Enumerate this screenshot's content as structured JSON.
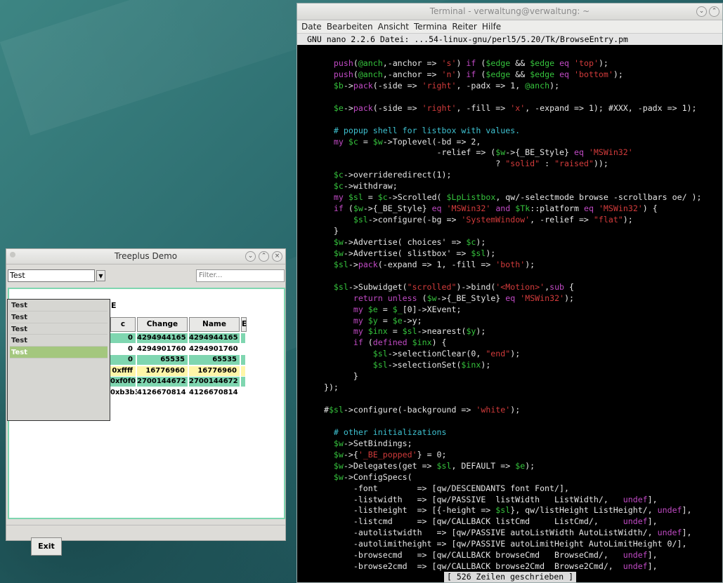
{
  "terminal": {
    "title": "Terminal - verwaltung@verwaltung: ~",
    "menu": [
      "Date",
      "Bearbeiten",
      "Ansicht",
      "Termina",
      "Reiter",
      "Hilfe"
    ],
    "nano_header": "GNU nano 2.2.6 Datei: ...54-linux-gnu/perl5/5.20/Tk/BrowseEntry.pm",
    "status": "[ 526 Zeilen geschrieben ]",
    "lines": [
      "",
      "    push(@anch,-anchor => 's') if ($edge && $edge eq 'top');",
      "    push(@anch,-anchor => 'n') if ($edge && $edge eq 'bottom');",
      "    $b->pack(-side => 'right', -padx => 1, @anch);",
      "",
      "    $e->pack(-side => 'right', -fill => 'x', -expand => 1); #XXX, -padx => 1);",
      "",
      "    # popup shell for listbox with values.",
      "    my $c = $w->Toplevel(-bd => 2,",
      "                         -relief => ($w->{_BE_Style} eq 'MSWin32'",
      "                                     ? \"solid\" : \"raised\"));",
      "    $c->overrideredirect(1);",
      "    $c->withdraw;",
      "    my $sl = $c->Scrolled( $LpListbox, qw/-selectmode browse -scrollbars oe/ );",
      "    if ($w->{_BE_Style} eq 'MSWin32' and $Tk::platform eq 'MSWin32') {",
      "        $sl->configure(-bg => 'SystemWindow', -relief => \"flat\");",
      "    }",
      "    $w->Advertise( choices' => $c);",
      "    $w->Advertise( slistbox' => $sl);",
      "    $sl->pack(-expand => 1, -fill => 'both');",
      "",
      "    $sl->Subwidget(\"scrolled\")->bind('<Motion>',sub {",
      "        return unless ($w->{_BE_Style} eq 'MSWin32');",
      "        my $e = $_[0]->XEvent;",
      "        my $y = $e->y;",
      "        my $inx = $sl->nearest($y);",
      "        if (defined $inx) {",
      "            $sl->selectionClear(0, \"end\");",
      "            $sl->selectionSet($inx);",
      "        }",
      "  });",
      "",
      "  #$sl->configure(-background => 'white');",
      "",
      "    # other initializations",
      "    $w->SetBindings;",
      "    $w->{'_BE_popped'} = 0;",
      "    $w->Delegates(get => $sl, DEFAULT => $e);",
      "    $w->ConfigSpecs(",
      "        -font        => [qw/DESCENDANTS font Font/],",
      "        -listwidth   => [qw/PASSIVE  listWidth   ListWidth/,   undef],",
      "        -listheight  => [{-height => $sl}, qw/listHeight ListHeight/, undef],",
      "        -listcmd     => [qw/CALLBACK listCmd     ListCmd/,     undef],",
      "        -autolistwidth   => [qw/PASSIVE autoListWidth AutoListWidth/, undef],",
      "        -autolimitheight => [qw/PASSIVE autoLimitHeight AutoLimitHeight 0/],",
      "        -browsecmd   => [qw/CALLBACK browseCmd   BrowseCmd/,   undef],",
      "        -browse2cmd  => [qw/CALLBACK browse2Cmd  Browse2Cmd/,  undef],"
    ],
    "colors": {
      "green": "#35c23c",
      "cyan": "#3ec1d0",
      "magenta": "#c04ac4",
      "red": "#d23b3b",
      "default": "#e6e6e6"
    }
  },
  "treeplus": {
    "title": "Treeplus Demo",
    "combo_value": "Test",
    "filter_placeholder": "Filter...",
    "tab_label": "E",
    "columns": [
      "Change",
      "Name"
    ],
    "dropdown_items": [
      "Test",
      "Test",
      "Test",
      "Test",
      "Test"
    ],
    "rows": [
      {
        "c0": "0",
        "c1": "4294944165",
        "c2": "4294944165",
        "bg": "#7fd6b0"
      },
      {
        "c0": "0",
        "c1": "4294901760",
        "c2": "4294901760",
        "bg": "#ffffff"
      },
      {
        "c0": "0",
        "c1": "65535",
        "c2": "65535",
        "bg": "#7fd6b0"
      },
      {
        "c0": "0xffff",
        "c1": "16776960",
        "c2": "16776960",
        "bg": "#fff6a8"
      },
      {
        "c0": "0xf0f0",
        "c1": "2700144672",
        "c2": "2700144672",
        "bg": "#7fd6b0"
      },
      {
        "c0": "0xb3b3",
        "c1": "4126670814",
        "c2": "4126670814",
        "bg": "#ffffff"
      }
    ],
    "exit_label": "Exit"
  }
}
